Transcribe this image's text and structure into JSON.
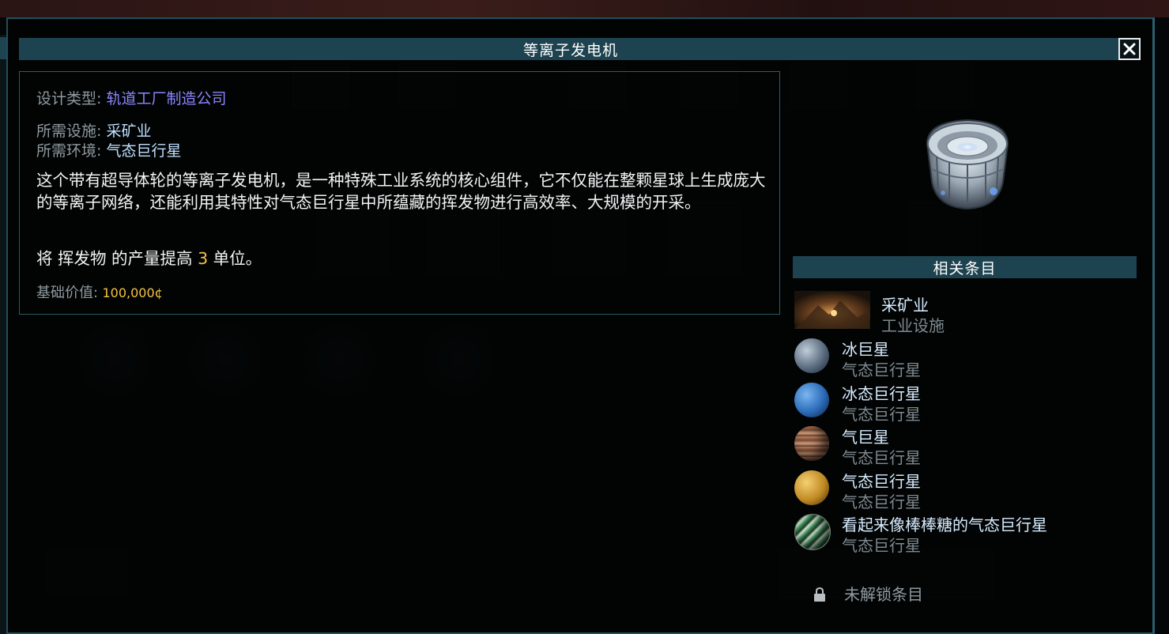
{
  "dialog": {
    "title": "等离子发电机",
    "close_glyph": "✕"
  },
  "info": {
    "design_type_label": "设计类型:",
    "design_type_value": "轨道工厂制造公司",
    "required_facility_label": "所需设施:",
    "required_facility_value": "采矿业",
    "required_env_label": "所需环境:",
    "required_env_value": "气态巨行星",
    "description": "这个带有超导体轮的等离子发电机，是一种特殊工业系统的核心组件，它不仅能在整颗星球上生成庞大的等离子网络，还能利用其特性对气态巨行星中所蕴藏的挥发物进行高效率、大规模的开采。",
    "effect_prefix": "将 挥发物 的产量提高 ",
    "effect_amount": "3",
    "effect_suffix": " 单位。",
    "base_value_label": "基础价值:",
    "base_value": "100,000¢"
  },
  "related": {
    "header": "相关条目",
    "items": [
      {
        "name": "采矿业",
        "type": "工业设施",
        "icon": "mining-facility-thumbnail"
      },
      {
        "name": "冰巨星",
        "type": "气态巨行星",
        "icon": "ice-giant-planet",
        "color": "#7a8fa8"
      },
      {
        "name": "冰态巨行星",
        "type": "气态巨行星",
        "icon": "ice-gas-giant-planet",
        "color": "#2f76c4"
      },
      {
        "name": "气巨星",
        "type": "气态巨行星",
        "icon": "gas-giant-planet",
        "color": "#a5654a"
      },
      {
        "name": "气态巨行星",
        "type": "气态巨行星",
        "icon": "gas-giant-planet-yellow",
        "color": "#d8a534"
      },
      {
        "name": "看起来像棒棒糖的气态巨行星",
        "type": "气态巨行星",
        "icon": "lollipop-gas-giant-planet",
        "color": "#3f8a5a"
      }
    ],
    "locked_label": "未解锁条目"
  }
}
